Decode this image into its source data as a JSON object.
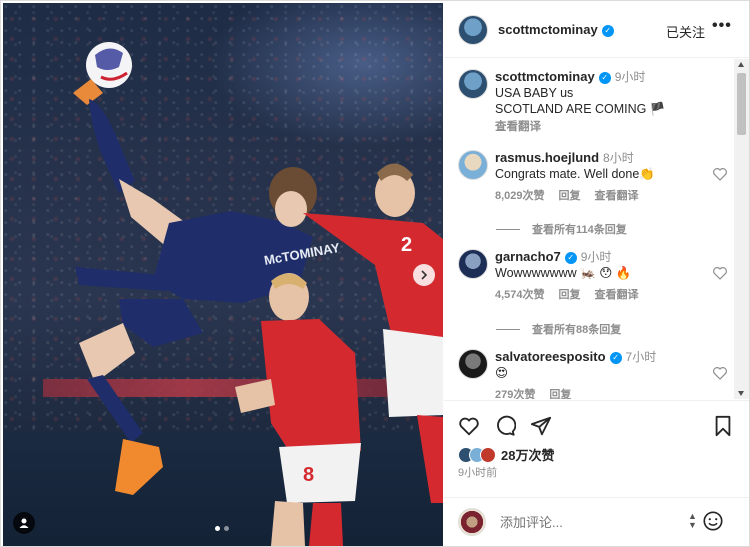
{
  "post": {
    "author": "scottmctominay",
    "follow_label": "已关注",
    "more_label": "•••",
    "caption": {
      "username": "scottmctominay",
      "time": "9小时",
      "line1": "USA BABY us",
      "line2": "SCOTLAND ARE COMING 🏴",
      "translate": "查看翻译"
    },
    "likes_text": "28万次赞",
    "post_time": "9小时前",
    "comment_placeholder": "添加评论...",
    "photo": {
      "player_name": "McTOMINAY",
      "opponent_numbers": [
        "2",
        "8"
      ],
      "carousel_dots": 2,
      "active_dot": 0
    }
  },
  "comments": [
    {
      "username": "rasmus.hoejlund",
      "time": "8小时",
      "text": "Congrats mate. Well done👏",
      "likes": "8,029次赞",
      "reply": "回复",
      "translate": "查看翻译",
      "view_replies": "查看所有114条回复",
      "avatar": "light"
    },
    {
      "username": "garnacho7",
      "time": "9小时",
      "text": "Wowwwwwww 🦗 😯 🔥",
      "likes": "4,574次赞",
      "reply": "回复",
      "translate": "查看翻译",
      "view_replies": "查看所有88条回复",
      "avatar": "navy"
    },
    {
      "username": "salvatoreesposito",
      "time": "7小时",
      "text": "😍",
      "likes": "279次赞",
      "reply": "回复",
      "avatar": "dark"
    }
  ],
  "colors": {
    "verified": "#0095f6",
    "secondary_text": "#8e8e8e",
    "scotland_kit": "#1f2d6b",
    "denmark_kit": "#d42a2f"
  },
  "icons": [
    "heart-icon",
    "comment-icon",
    "share-icon",
    "bookmark-icon",
    "emoji-icon",
    "verified-icon",
    "chevron-right-icon",
    "person-tag-icon"
  ]
}
